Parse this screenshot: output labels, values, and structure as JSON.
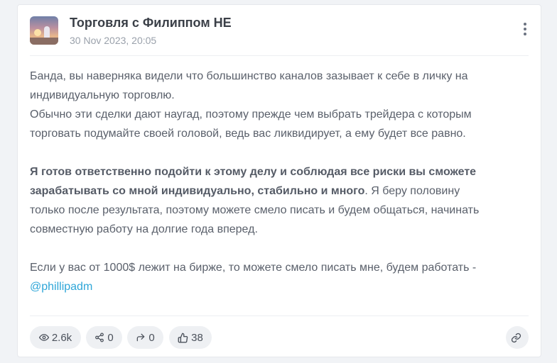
{
  "channel": {
    "name": "Торговля с Филиппом НЕ",
    "date": "30 Nov 2023, 20:05"
  },
  "post": {
    "para1_line1": "Банда, вы наверняка видели что большинство каналов зазывает к себе в личку на",
    "para1_line2": "индивидуальную торговлю.",
    "para2_line1": "Обычно эти сделки дают наугад, поэтому прежде чем выбрать трейдера с которым",
    "para2_line2": "торговать подумайте своей головой, ведь вас ликвидирует, а ему будет все равно.",
    "bold_line1": "Я готов ответственно подойти к этому делу и соблюдая все риски вы сможете",
    "bold_line2": "зарабатывать со мной индивидуально, стабильно и много",
    "para3_tail": ". Я беру половину",
    "para3_line2": "только после результата, поэтому можете смело писать и будем общаться, начинать",
    "para3_line3": "совместную работу на долгие года вперед.",
    "para4_line1": "Если у вас от 1000$ лежит на бирже, то можете смело писать мне, будем работать -",
    "mention": "@phillipadm"
  },
  "stats": {
    "views": "2.6k",
    "shares": "0",
    "forwards": "0",
    "reactions": "38"
  },
  "icons": {
    "views": "eye-icon",
    "shares": "share-icon",
    "forwards": "forward-icon",
    "reactions": "thumbs-up-icon",
    "link": "link-icon",
    "more": "more-vertical-icon"
  },
  "colors": {
    "mention": "#2ea6d8",
    "background": "#f1f3f6",
    "card": "#ffffff"
  }
}
